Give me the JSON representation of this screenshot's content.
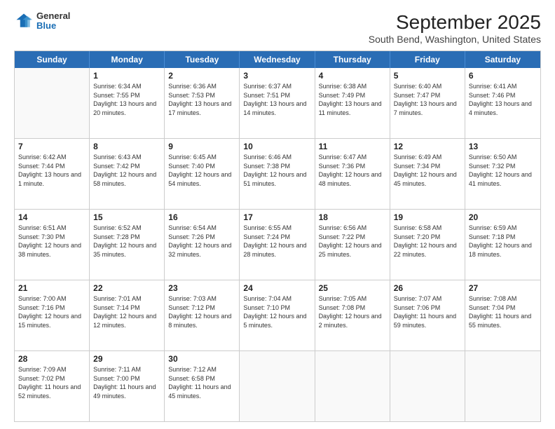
{
  "logo": {
    "line1": "General",
    "line2": "Blue"
  },
  "title": "September 2025",
  "subtitle": "South Bend, Washington, United States",
  "days_of_week": [
    "Sunday",
    "Monday",
    "Tuesday",
    "Wednesday",
    "Thursday",
    "Friday",
    "Saturday"
  ],
  "weeks": [
    [
      {
        "day": "",
        "info": ""
      },
      {
        "day": "1",
        "info": "Sunrise: 6:34 AM\nSunset: 7:55 PM\nDaylight: 13 hours\nand 20 minutes."
      },
      {
        "day": "2",
        "info": "Sunrise: 6:36 AM\nSunset: 7:53 PM\nDaylight: 13 hours\nand 17 minutes."
      },
      {
        "day": "3",
        "info": "Sunrise: 6:37 AM\nSunset: 7:51 PM\nDaylight: 13 hours\nand 14 minutes."
      },
      {
        "day": "4",
        "info": "Sunrise: 6:38 AM\nSunset: 7:49 PM\nDaylight: 13 hours\nand 11 minutes."
      },
      {
        "day": "5",
        "info": "Sunrise: 6:40 AM\nSunset: 7:47 PM\nDaylight: 13 hours\nand 7 minutes."
      },
      {
        "day": "6",
        "info": "Sunrise: 6:41 AM\nSunset: 7:46 PM\nDaylight: 13 hours\nand 4 minutes."
      }
    ],
    [
      {
        "day": "7",
        "info": "Sunrise: 6:42 AM\nSunset: 7:44 PM\nDaylight: 13 hours\nand 1 minute."
      },
      {
        "day": "8",
        "info": "Sunrise: 6:43 AM\nSunset: 7:42 PM\nDaylight: 12 hours\nand 58 minutes."
      },
      {
        "day": "9",
        "info": "Sunrise: 6:45 AM\nSunset: 7:40 PM\nDaylight: 12 hours\nand 54 minutes."
      },
      {
        "day": "10",
        "info": "Sunrise: 6:46 AM\nSunset: 7:38 PM\nDaylight: 12 hours\nand 51 minutes."
      },
      {
        "day": "11",
        "info": "Sunrise: 6:47 AM\nSunset: 7:36 PM\nDaylight: 12 hours\nand 48 minutes."
      },
      {
        "day": "12",
        "info": "Sunrise: 6:49 AM\nSunset: 7:34 PM\nDaylight: 12 hours\nand 45 minutes."
      },
      {
        "day": "13",
        "info": "Sunrise: 6:50 AM\nSunset: 7:32 PM\nDaylight: 12 hours\nand 41 minutes."
      }
    ],
    [
      {
        "day": "14",
        "info": "Sunrise: 6:51 AM\nSunset: 7:30 PM\nDaylight: 12 hours\nand 38 minutes."
      },
      {
        "day": "15",
        "info": "Sunrise: 6:52 AM\nSunset: 7:28 PM\nDaylight: 12 hours\nand 35 minutes."
      },
      {
        "day": "16",
        "info": "Sunrise: 6:54 AM\nSunset: 7:26 PM\nDaylight: 12 hours\nand 32 minutes."
      },
      {
        "day": "17",
        "info": "Sunrise: 6:55 AM\nSunset: 7:24 PM\nDaylight: 12 hours\nand 28 minutes."
      },
      {
        "day": "18",
        "info": "Sunrise: 6:56 AM\nSunset: 7:22 PM\nDaylight: 12 hours\nand 25 minutes."
      },
      {
        "day": "19",
        "info": "Sunrise: 6:58 AM\nSunset: 7:20 PM\nDaylight: 12 hours\nand 22 minutes."
      },
      {
        "day": "20",
        "info": "Sunrise: 6:59 AM\nSunset: 7:18 PM\nDaylight: 12 hours\nand 18 minutes."
      }
    ],
    [
      {
        "day": "21",
        "info": "Sunrise: 7:00 AM\nSunset: 7:16 PM\nDaylight: 12 hours\nand 15 minutes."
      },
      {
        "day": "22",
        "info": "Sunrise: 7:01 AM\nSunset: 7:14 PM\nDaylight: 12 hours\nand 12 minutes."
      },
      {
        "day": "23",
        "info": "Sunrise: 7:03 AM\nSunset: 7:12 PM\nDaylight: 12 hours\nand 8 minutes."
      },
      {
        "day": "24",
        "info": "Sunrise: 7:04 AM\nSunset: 7:10 PM\nDaylight: 12 hours\nand 5 minutes."
      },
      {
        "day": "25",
        "info": "Sunrise: 7:05 AM\nSunset: 7:08 PM\nDaylight: 12 hours\nand 2 minutes."
      },
      {
        "day": "26",
        "info": "Sunrise: 7:07 AM\nSunset: 7:06 PM\nDaylight: 11 hours\nand 59 minutes."
      },
      {
        "day": "27",
        "info": "Sunrise: 7:08 AM\nSunset: 7:04 PM\nDaylight: 11 hours\nand 55 minutes."
      }
    ],
    [
      {
        "day": "28",
        "info": "Sunrise: 7:09 AM\nSunset: 7:02 PM\nDaylight: 11 hours\nand 52 minutes."
      },
      {
        "day": "29",
        "info": "Sunrise: 7:11 AM\nSunset: 7:00 PM\nDaylight: 11 hours\nand 49 minutes."
      },
      {
        "day": "30",
        "info": "Sunrise: 7:12 AM\nSunset: 6:58 PM\nDaylight: 11 hours\nand 45 minutes."
      },
      {
        "day": "",
        "info": ""
      },
      {
        "day": "",
        "info": ""
      },
      {
        "day": "",
        "info": ""
      },
      {
        "day": "",
        "info": ""
      }
    ]
  ]
}
